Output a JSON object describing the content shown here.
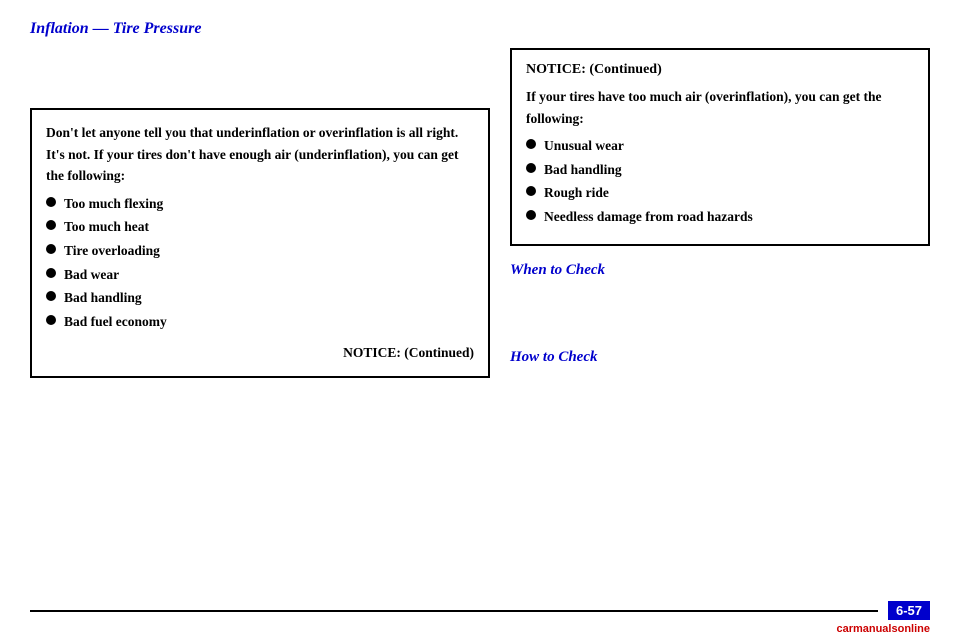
{
  "page": {
    "title": "Inflation — Tire Pressure",
    "page_number": "6-57"
  },
  "left_column": {
    "notice_box": {
      "intro_text": "Don't let anyone tell you that underinflation or overinflation is all right. It's not. If your tires don't have enough air (underinflation), you can get the following:",
      "bullet_items": [
        "Too much flexing",
        "Too much heat",
        "Tire overloading",
        "Bad wear",
        "Bad handling",
        "Bad fuel economy"
      ],
      "continued_label": "NOTICE: (Continued)"
    }
  },
  "right_column": {
    "notice_box": {
      "header": "NOTICE: (Continued)",
      "intro_text": "If your tires have too much air (overinflation), you can get the following:",
      "bullet_items": [
        "Unusual wear",
        "Bad handling",
        "Rough ride",
        "Needless damage from road hazards"
      ]
    },
    "when_to_check_heading": "When to Check",
    "how_to_check_heading": "How to Check"
  },
  "bottom": {
    "page_number": "6-57",
    "watermark": "carmanualsonline"
  },
  "icons": {
    "bullet": "●"
  }
}
